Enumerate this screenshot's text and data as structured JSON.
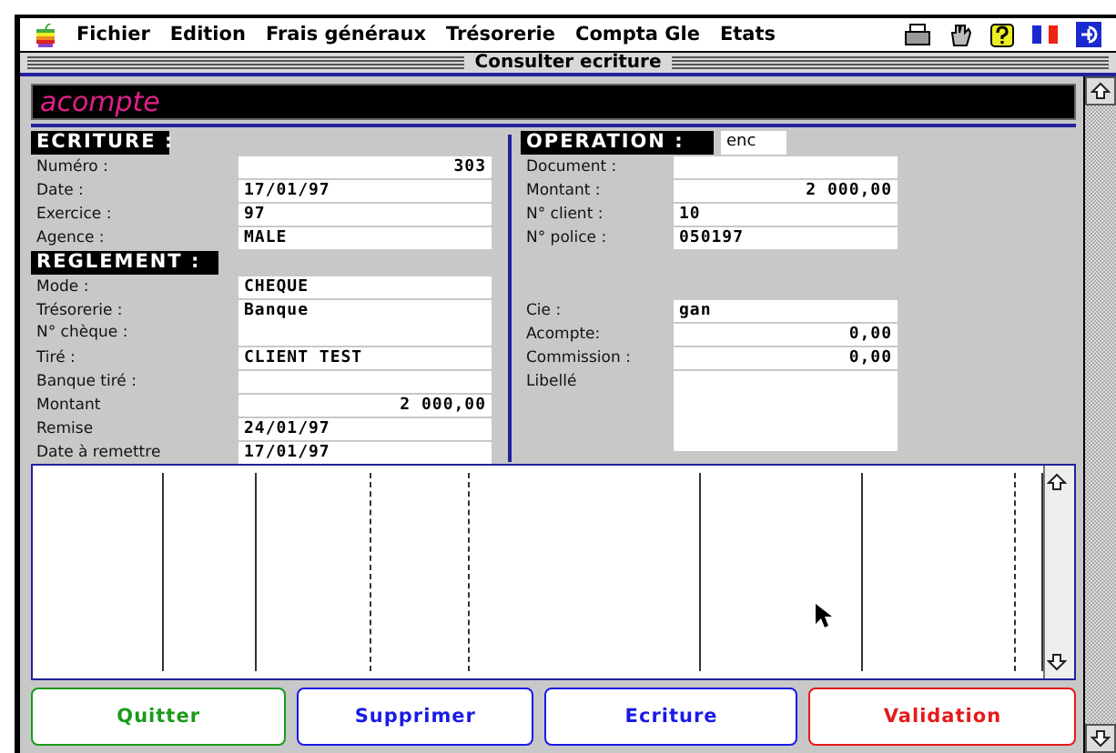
{
  "menu": [
    "Fichier",
    "Edition",
    "Frais généraux",
    "Trésorerie",
    "Compta Gle",
    "Etats"
  ],
  "window": {
    "title": "Consulter ecriture"
  },
  "record_title": "acompte",
  "ecriture": {
    "heading": "ECRITURE :",
    "fields": [
      {
        "label": "Numéro :",
        "value": "303",
        "kind": "number"
      },
      {
        "label": "Date :",
        "value": "17/01/97",
        "kind": "text"
      },
      {
        "label": "Exercice :",
        "value": "97",
        "kind": "text"
      },
      {
        "label": "Agence :",
        "value": "MALE",
        "kind": "text"
      }
    ]
  },
  "reglement": {
    "heading": "REGLEMENT :",
    "fields": [
      {
        "labels": [
          "Mode :"
        ],
        "value": "CHEQUE",
        "kind": "text"
      },
      {
        "labels": [
          "Trésorerie :",
          "N° chèque :"
        ],
        "value": "Banque",
        "kind": "text"
      },
      {
        "labels": [
          "Tiré :"
        ],
        "value": "CLIENT TEST",
        "kind": "text"
      },
      {
        "labels": [
          "Banque tiré :"
        ],
        "kind": "text"
      },
      {
        "labels": [
          "Montant"
        ],
        "value": "2 000,00",
        "kind": "number"
      },
      {
        "labels": [
          "Remise"
        ],
        "value": "24/01/97",
        "kind": "text"
      },
      {
        "labels": [
          "Date à remettre"
        ],
        "value": "17/01/97",
        "kind": "text"
      }
    ]
  },
  "operation": {
    "heading": "OPERATION :",
    "type": "enc",
    "fields": [
      {
        "label": "Document :",
        "kind": "text"
      },
      {
        "label": "Montant  :",
        "value": "2 000,00",
        "kind": "number"
      },
      {
        "label": "N° client :",
        "value": "10",
        "kind": "text"
      },
      {
        "label": "N° police :",
        "value": "050197",
        "kind": "text"
      }
    ],
    "fields_2": [
      {
        "label": "Cie :",
        "value": "gan",
        "kind": "text"
      },
      {
        "label": "Acompte:",
        "value": "0,00",
        "kind": "number"
      },
      {
        "label": "Commission :",
        "value": "0,00",
        "kind": "number"
      }
    ],
    "libelle": {
      "label": "Libellé"
    }
  },
  "buttons": [
    {
      "label": "Quitter",
      "color": "#1a9a1a"
    },
    {
      "label": "Supprimer",
      "color": "#1a1ae6"
    },
    {
      "label": "Ecriture",
      "color": "#1a1ae6"
    },
    {
      "label": "Validation",
      "color": "#e61a1a"
    }
  ]
}
